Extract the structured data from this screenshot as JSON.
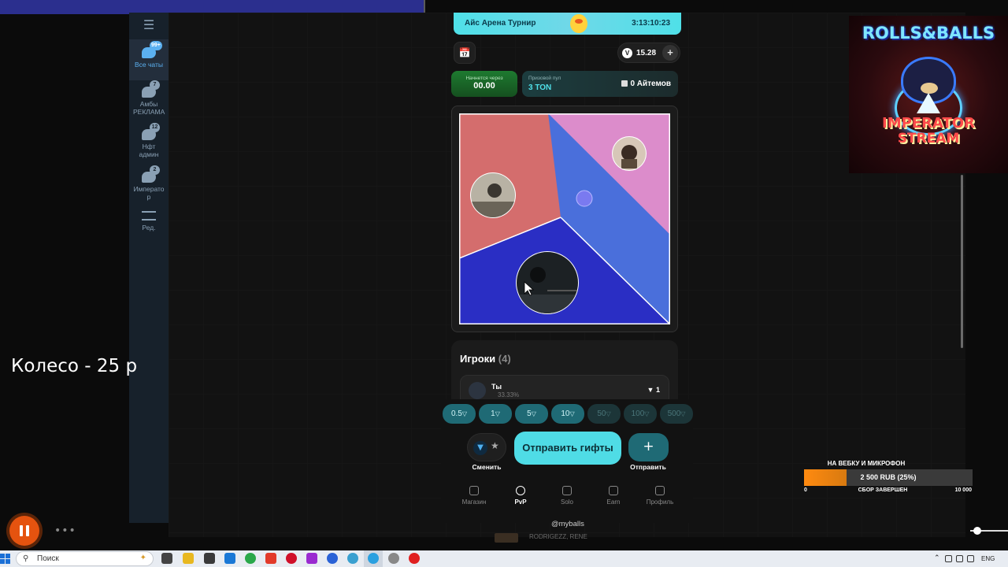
{
  "telegram": {
    "folders": [
      {
        "label": "Все чаты",
        "badge": "99+",
        "active": true
      },
      {
        "label": "Амбы РЕКЛАМА",
        "badge": "7",
        "active": false
      },
      {
        "label": "Нфт админ",
        "badge": "12",
        "active": false
      },
      {
        "label": "Императо р",
        "badge": "2",
        "active": false
      },
      {
        "label": "Ред.",
        "badge": "",
        "active": false
      }
    ]
  },
  "game": {
    "tournament_name": "Айс Арена Турнир",
    "tournament_timer": "3:13:10:23",
    "balance": "15.28",
    "starts_label": "Начнется через",
    "starts_value": "00.00",
    "pool_label": "Призовой пул",
    "pool_value": "3 TON",
    "items_count": "0 Айтемов",
    "players_title": "Игроки",
    "players_count": "(4)",
    "player_row": {
      "name": "Ты",
      "percent": "33.33%",
      "bet": "1"
    },
    "bet_chips": [
      "0.5",
      "1",
      "5",
      "10",
      "50",
      "100",
      "500"
    ],
    "swap_label": "Сменить",
    "send_gifts_label": "Отправить гифты",
    "send_label": "Отправить",
    "nav": [
      "Магазин",
      "PvP",
      "Solo",
      "Earn",
      "Профиль"
    ],
    "nav_active": "PvP",
    "handle": "@myballs",
    "peek_text": "RODRIGEZZ, RENE",
    "board_colors": {
      "pink": "#e07a7a",
      "blue": "#4a6fdb",
      "lilac": "#d98cc8",
      "dark_blue": "#2b2fc8"
    }
  },
  "overlay": {
    "wheel_text": "Колесо - 25 р",
    "logo_title": "ROLLS&BALLS",
    "logo_sub1": "IMPERATOR",
    "logo_sub2": "STREAM",
    "donation_title": "НА ВЕБКУ И МИКРОФОН",
    "donation_amount": "2 500 RUB (25%)",
    "donation_progress": 0.25,
    "donation_min": "0",
    "donation_status": "СБОР ЗАВЕРШЕН",
    "donation_max": "10 000"
  },
  "taskbar": {
    "search_placeholder": "Поиск",
    "lang": "ENG"
  }
}
